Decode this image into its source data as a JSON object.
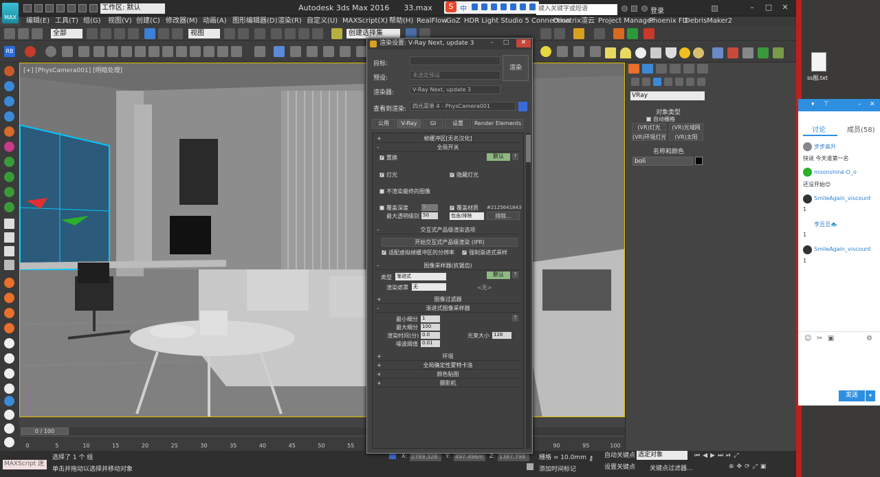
{
  "titlebar": {
    "workspace": "工作区: 默认",
    "app_title": "Autodesk 3ds Max 2016",
    "file_name": "33.max",
    "search_placeholder": "键入关键字或短语",
    "login": "登录",
    "ime_logo": "S",
    "ime_mode": "中"
  },
  "menus": [
    "编辑(E)",
    "工具(T)",
    "组(G)",
    "视图(V)",
    "创建(C)",
    "修改器(M)",
    "动画(A)",
    "图形编辑器(D)",
    "渲染(R)",
    "自定义(U)",
    "MAXScript(X)",
    "帮助(H)",
    "RealFlow",
    "GoZ",
    "HDR Light Studio 5 Connection",
    "Ornatrix",
    "渲云",
    "Project Manager",
    "Phoenix FD",
    "DebrisMaker2"
  ],
  "toolbar": {
    "filter": "全部",
    "coord_system": "视图",
    "named_selection": "创建选择集",
    "rb_label": "RB"
  },
  "viewport": {
    "label": "[+] [PhysCamera001] [明暗处理]"
  },
  "command_panel": {
    "renderer": "VRay",
    "object_type_title": "对象类型",
    "auto_grid": "自动栅格",
    "buttons": [
      "(VR)灯光",
      "(VR)光域网",
      "(VR)环境灯光",
      "(VR)太阳"
    ],
    "name_color_title": "名称和颜色",
    "object_name": "boli"
  },
  "dialog": {
    "title": "渲染设置: V-Ray Next, update 3",
    "target_label": "目标:",
    "preset_label": "预设:",
    "preset_value": "未选定预设",
    "renderer_label": "渲染器:",
    "renderer_value": "V-Ray Next, update 3",
    "view_label": "查看到渲染:",
    "view_value": "四元菜单 4 - PhysCamera001",
    "render_button": "渲染",
    "tabs": [
      "公用",
      "V-Ray",
      "GI",
      "设置",
      "Render Elements"
    ],
    "active_tab": "V-Ray",
    "rollouts": {
      "frame_buffer": "帧缓冲区[无名汉化]",
      "global_switches": "全局开关",
      "displacement": "置换",
      "default": "默认",
      "lights": "灯光",
      "hidden_lights": "隐藏灯光",
      "dont_render_final": "不渲染最终的图像",
      "override_depth": "覆盖深度",
      "depth_value": "5",
      "override_mtl": "覆盖材质",
      "mtl_id": "#2125641843",
      "max_transp": "最大透明级别",
      "max_transp_value": "50",
      "include_exclude": "包含/排除",
      "exclude_btn": "排除...",
      "ipr_title": "交互式产品级渲染选项",
      "ipr_start": "开始交互式产品级渲染 (IPR)",
      "fit_vfb": "适配虚拟帧缓冲区的分辨率",
      "force_progressive": "强制渐进式采样",
      "image_sampler": "图像采样器(抗锯齿)",
      "type_label": "类型",
      "type_value": "渐进式",
      "render_mask": "渲染遮罩",
      "render_mask_value": "无",
      "none_tag": "<无>",
      "image_filter": "图像过滤器",
      "progressive_sampler": "渐进式图像采样器",
      "min_subdivs": "最小细分",
      "min_subdivs_value": "1",
      "max_subdivs": "最大细分",
      "max_subdivs_value": "100",
      "render_time": "渲染时间(分)",
      "render_time_value": "0.0",
      "noise_threshold": "噪波阈值",
      "noise_threshold_value": "0.01",
      "bundle_size": "光束大小",
      "bundle_size_value": "128",
      "environment": "环境",
      "qmc": "全局确定性蒙特卡洛",
      "color_mapping": "颜色贴图",
      "camera": "摄影机"
    }
  },
  "timeline": {
    "slider": "0 / 100",
    "ticks": [
      "0",
      "5",
      "10",
      "15",
      "20",
      "25",
      "30",
      "35",
      "40",
      "45",
      "50",
      "55",
      "60",
      "65",
      "70",
      "75",
      "80",
      "85",
      "90",
      "95",
      "100"
    ]
  },
  "status": {
    "maxscript": "MAXScript 迷",
    "selected": "选择了 1 个 组",
    "hint": "单击并拖动以选择并移动对象",
    "x": "2789.328",
    "y": "497.496m",
    "z": "1387.798",
    "grid": "栅格 = 10.0mm",
    "add_time_tag": "添加时间标记",
    "auto_key": "自动关键点",
    "set_key": "设置关键点",
    "selected_object": "选定对象",
    "key_filters": "关键点过滤器..."
  },
  "desktop": {
    "file_label": "ss图.txt"
  },
  "chat": {
    "tab_discuss": "讨论",
    "tab_members": "成员(58)",
    "messages": [
      {
        "name": "步步高升",
        "text": "快说 今天谁第一名"
      },
      {
        "name": "moonshine·O_o",
        "text": "还没开始😊"
      },
      {
        "name": "SmileAgain_viscount",
        "text": "1"
      },
      {
        "name": "李丑丑🐟",
        "text": "1"
      },
      {
        "name": "SmileAgain_viscount",
        "text": "1"
      }
    ],
    "send": "发送"
  },
  "colors": {
    "accent": "#2e8fe0",
    "selection": "#00c8ff",
    "default_green": "#8fb884",
    "border_red": "#c0201b"
  }
}
